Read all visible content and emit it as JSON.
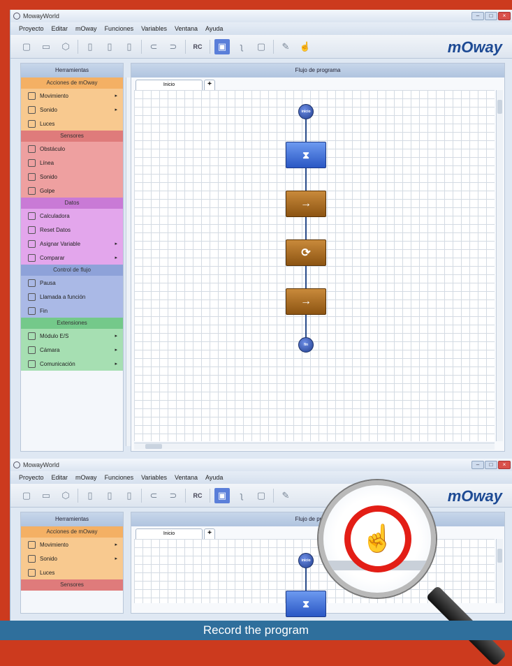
{
  "caption": "Record the program",
  "windows": [
    {
      "title": "MowayWorld",
      "menu": [
        "Proyecto",
        "Editar",
        "mOway",
        "Funciones",
        "Variables",
        "Ventana",
        "Ayuda"
      ],
      "brand": "mOway",
      "toolbar_rc": "RC",
      "tools_panel": {
        "header": "Herramientas",
        "categories": [
          {
            "label": "Acciones de mOway",
            "color": "#f4b064",
            "bg": "#f8c98f",
            "items": [
              {
                "label": "Movimiento",
                "arrow": true,
                "icon": "turn-icon"
              },
              {
                "label": "Sonido",
                "arrow": true,
                "icon": "speaker-icon"
              },
              {
                "label": "Luces",
                "arrow": false,
                "icon": "light-icon"
              }
            ]
          },
          {
            "label": "Sensores",
            "color": "#df7b7b",
            "bg": "#eea0a0",
            "items": [
              {
                "label": "Obstáculo",
                "arrow": false,
                "icon": "obstacle-icon"
              },
              {
                "label": "Línea",
                "arrow": false,
                "icon": "line-sensor-icon"
              },
              {
                "label": "Sonido",
                "arrow": false,
                "icon": "sound-sensor-icon"
              },
              {
                "label": "Golpe",
                "arrow": false,
                "icon": "bump-icon"
              }
            ]
          },
          {
            "label": "Datos",
            "color": "#c97ad6",
            "bg": "#e3a6ec",
            "items": [
              {
                "label": "Calculadora",
                "arrow": false,
                "icon": "calculator-icon"
              },
              {
                "label": "Reset Datos",
                "arrow": false,
                "icon": "reset-icon"
              },
              {
                "label": "Asignar Variable",
                "arrow": true,
                "icon": "assign-icon"
              },
              {
                "label": "Comparar",
                "arrow": true,
                "icon": "compare-icon"
              }
            ]
          },
          {
            "label": "Control de flujo",
            "color": "#8ea2d9",
            "bg": "#aab9e6",
            "items": [
              {
                "label": "Pausa",
                "arrow": false,
                "icon": "pause-icon"
              },
              {
                "label": "Llamada a función",
                "arrow": false,
                "icon": "function-icon"
              },
              {
                "label": "Fin",
                "arrow": false,
                "icon": "end-icon"
              }
            ]
          },
          {
            "label": "Extensiones",
            "color": "#74c98a",
            "bg": "#a6dfb2",
            "items": [
              {
                "label": "Módulo E/S",
                "arrow": true,
                "icon": "io-icon"
              },
              {
                "label": "Cámara",
                "arrow": true,
                "icon": "camera-icon"
              },
              {
                "label": "Comunicación",
                "arrow": true,
                "icon": "radio-icon"
              }
            ]
          }
        ]
      },
      "flow_panel": {
        "header": "Flujo de programa",
        "tab": "Inicio",
        "tab_add": "+"
      },
      "flow": [
        {
          "type": "circle",
          "label": "inicio",
          "symbol": "start-icon"
        },
        {
          "type": "blue",
          "label": "⧗",
          "symbol": "hourglass-icon"
        },
        {
          "type": "orange",
          "label": "→",
          "symbol": "arrow-right-icon"
        },
        {
          "type": "orange",
          "label": "⟳",
          "symbol": "rotate-icon"
        },
        {
          "type": "orange",
          "label": "→",
          "symbol": "arrow-right-icon"
        },
        {
          "type": "circle",
          "label": "fin",
          "symbol": "end-icon"
        }
      ]
    }
  ],
  "magnifier": {
    "highlight": "record-hand-icon",
    "glyph": "☝"
  }
}
